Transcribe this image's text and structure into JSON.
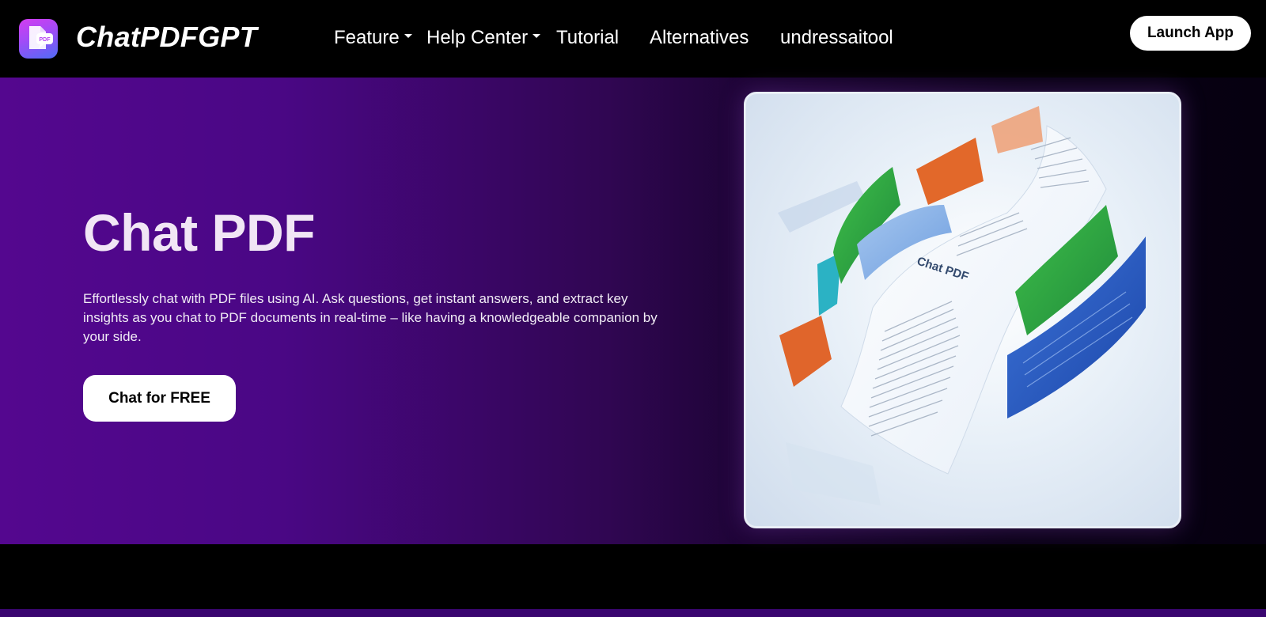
{
  "header": {
    "logo_icon": "pdf-chat-logo-icon",
    "logo_badge": "PDF",
    "brand": "ChatPDFGPT",
    "nav": {
      "feature": "Feature",
      "help_center": "Help Center",
      "tutorial": "Tutorial",
      "alternatives": "Alternatives",
      "undressaitool": "undressaitool"
    },
    "launch_button": "Launch App"
  },
  "hero": {
    "title": "Chat PDF",
    "description": "Effortlessly chat with PDF files using AI. Ask questions, get instant answers, and extract key insights as you chat to PDF documents in real-time – like having a knowledgeable companion by your side.",
    "cta_button": "Chat for FREE",
    "illustration_caption": "Chat PDF",
    "illustration_icon": "flowing-pdf-pages-illustration"
  },
  "colors": {
    "hero_gradient_start": "#54078f",
    "hero_gradient_end": "#060010",
    "header_bg": "#000000",
    "button_bg": "#ffffff"
  }
}
